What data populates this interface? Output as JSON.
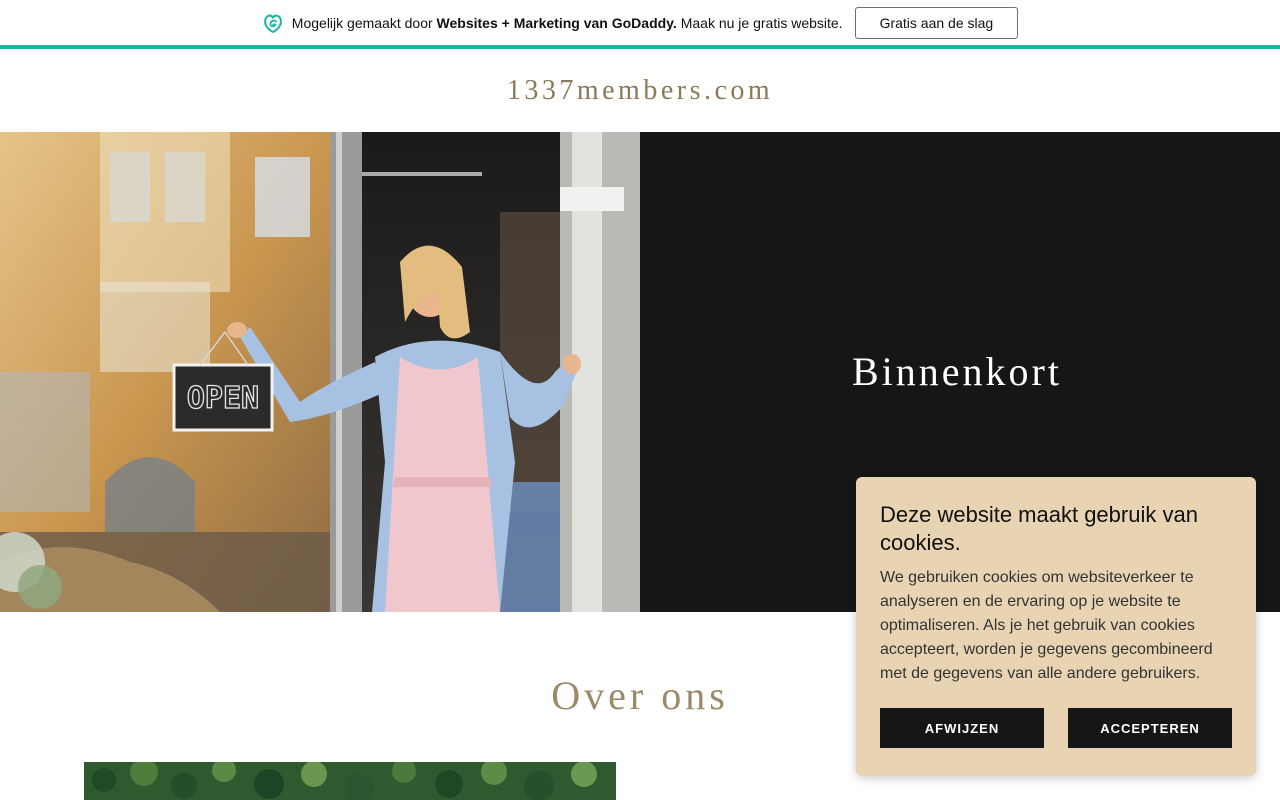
{
  "promo": {
    "text_before": "Mogelijk gemaakt door ",
    "text_bold": "Websites + Marketing van GoDaddy.",
    "text_after": " Maak nu je gratis website.",
    "button_label": "Gratis aan de slag",
    "logo_icon": "godaddy-logo-icon",
    "accent_color": "#1bb5a8"
  },
  "header": {
    "site_title": "1337members.com"
  },
  "hero": {
    "heading": "Binnenkort",
    "sign_text": "OPEN"
  },
  "about": {
    "heading": "Over ons"
  },
  "cookies": {
    "title": "Deze website maakt gebruik van cookies.",
    "body": "We gebruiken cookies om websiteverkeer te analyseren en de ervaring op je website te optimaliseren. Als je het gebruik van cookies accepteert, worden je gegevens gecombineerd met de gegevens van alle andere gebruikers.",
    "reject_label": "AFWIJZEN",
    "accept_label": "ACCEPTEREN",
    "background_color": "#e8d3b2"
  }
}
